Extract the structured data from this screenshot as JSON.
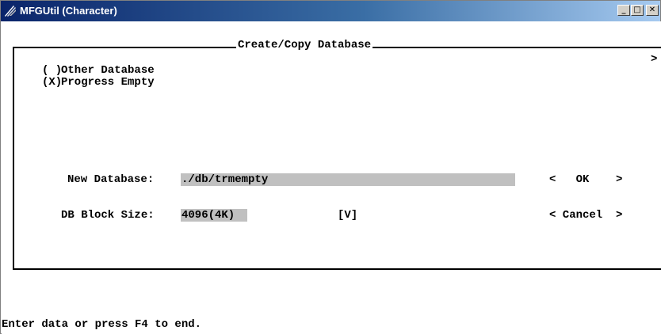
{
  "window": {
    "title": "MFGUtil (Character)",
    "controls": {
      "minimize": "_",
      "maximize": "□",
      "close": "✕"
    }
  },
  "dialog": {
    "title": "Create/Copy Database",
    "scroll_indicator": ">",
    "options": [
      {
        "marker": "( )",
        "label": "Other Database"
      },
      {
        "marker": "(X)",
        "label": "Progress Empty"
      }
    ],
    "new_database": {
      "label": "New Database:",
      "value": "./db/trmempty"
    },
    "block_size": {
      "label": "DB Block Size:",
      "value": "4096(4K)",
      "dropdown": "[V]"
    },
    "buttons": {
      "ok": "<   OK    >",
      "cancel": "< Cancel  >"
    }
  },
  "status_line": "Enter data or press F4 to end.",
  "colors": {
    "titlebar_start": "#0a246a",
    "titlebar_end": "#a6caf0",
    "field_bg": "#c0c0c0"
  }
}
